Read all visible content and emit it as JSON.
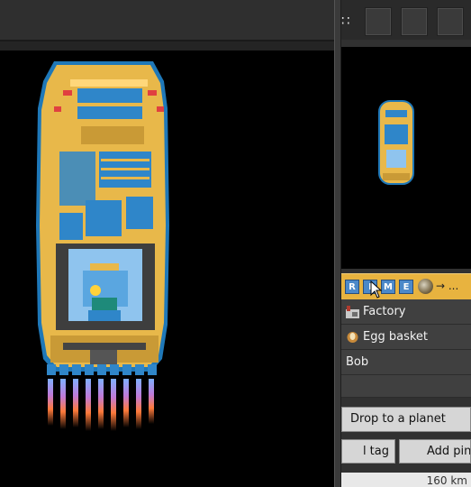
{
  "ship_panel": {
    "buttons": [
      "R",
      "I",
      "M",
      "E"
    ],
    "destination": "→ ..."
  },
  "items": [
    {
      "label": "Factory",
      "icon": "factory-icon"
    },
    {
      "label": "Egg basket",
      "icon": "egg-basket-icon"
    },
    {
      "label": "Bob",
      "icon": ""
    },
    {
      "label": "",
      "icon": ""
    }
  ],
  "actions": {
    "drop_label": "Drop to a planet",
    "tag_label": "l tag",
    "ping_label": "Add ping"
  },
  "status": {
    "distance": "160 km"
  },
  "colors": {
    "hull": "#e8b84a",
    "module": "#3b8ed0",
    "accent": "#e8b33f",
    "thruster": "#ff7a3a"
  }
}
